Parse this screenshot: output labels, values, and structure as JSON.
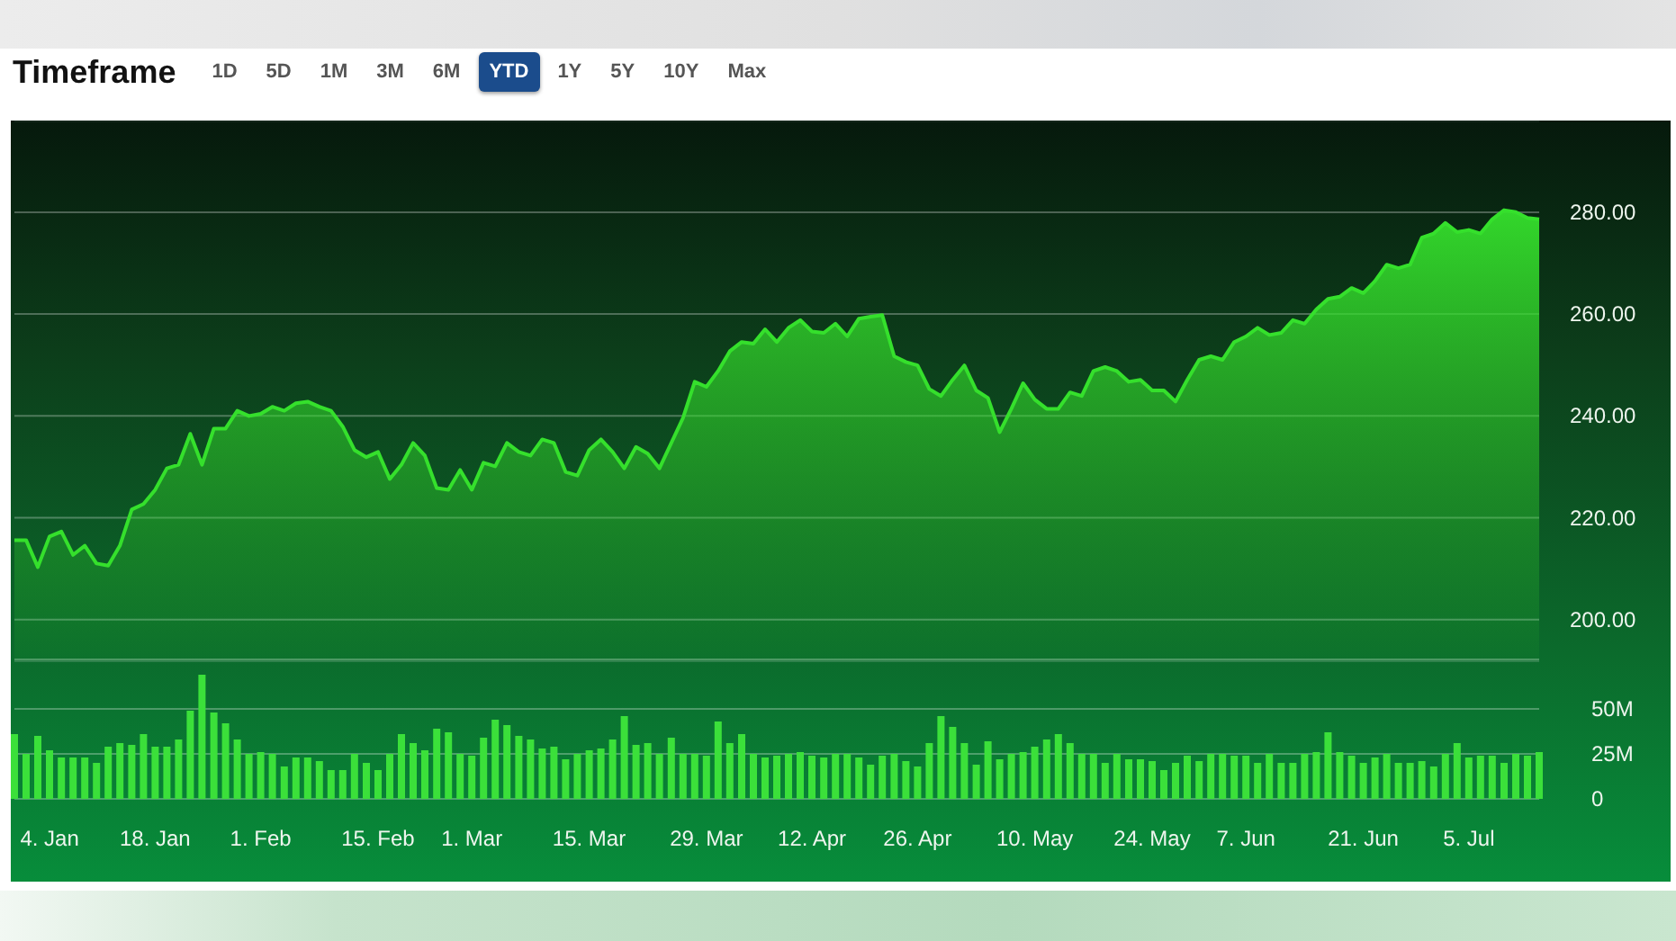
{
  "header": {
    "title": "Timeframe",
    "tabs": [
      {
        "label": "1D",
        "selected": false
      },
      {
        "label": "5D",
        "selected": false
      },
      {
        "label": "1M",
        "selected": false
      },
      {
        "label": "3M",
        "selected": false
      },
      {
        "label": "6M",
        "selected": false
      },
      {
        "label": "YTD",
        "selected": true
      },
      {
        "label": "1Y",
        "selected": false
      },
      {
        "label": "5Y",
        "selected": false
      },
      {
        "label": "10Y",
        "selected": false
      },
      {
        "label": "Max",
        "selected": false
      }
    ]
  },
  "price_chart": {
    "chart_data": {
      "type": "area",
      "grid": true,
      "ylim": [
        192,
        298
      ],
      "yticks": [
        {
          "value": 200,
          "label": "200.00"
        },
        {
          "value": 220,
          "label": "220.00"
        },
        {
          "value": 240,
          "label": "240.00"
        },
        {
          "value": 260,
          "label": "260.00"
        },
        {
          "value": 280,
          "label": "280.00"
        }
      ],
      "series": [
        {
          "color": "#35e02c",
          "values": [
            215.6,
            215.6,
            210.3,
            216.3,
            217.3,
            212.7,
            214.5,
            211.0,
            210.6,
            214.5,
            221.6,
            222.7,
            225.5,
            229.7,
            230.4,
            236.5,
            230.4,
            237.5,
            237.5,
            241.0,
            240.0,
            240.4,
            241.8,
            241.0,
            242.5,
            242.8,
            241.8,
            241.0,
            237.9,
            233.3,
            231.9,
            232.9,
            227.6,
            230.4,
            234.7,
            232.2,
            225.8,
            225.5,
            229.4,
            225.5,
            230.8,
            230.1,
            234.7,
            232.9,
            232.2,
            235.4,
            234.7,
            229.0,
            228.3,
            233.3,
            235.4,
            232.9,
            229.7,
            233.9,
            232.6,
            229.7,
            234.7,
            239.6,
            246.7,
            245.7,
            248.8,
            252.7,
            254.5,
            254.2,
            257.0,
            254.5,
            257.3,
            258.8,
            256.6,
            256.3,
            258.1,
            255.6,
            259.1,
            259.5,
            259.8,
            251.7,
            250.6,
            249.9,
            245.3,
            243.9,
            247.1,
            249.9,
            245.0,
            243.5,
            236.8,
            241.4,
            246.4,
            243.2,
            241.4,
            241.4,
            244.6,
            243.9,
            248.8,
            249.6,
            248.8,
            246.7,
            247.1,
            245.0,
            245.0,
            242.8,
            247.1,
            251.0,
            251.7,
            251.0,
            254.5,
            255.6,
            257.3,
            255.9,
            256.3,
            258.8,
            258.1,
            260.9,
            263.0,
            263.4,
            265.1,
            264.1,
            266.5,
            269.7,
            269.0,
            269.7,
            275.0,
            275.8,
            277.9,
            276.1,
            276.5,
            275.8,
            278.6,
            280.4,
            280.0,
            278.9,
            278.6
          ]
        }
      ]
    }
  },
  "volume_chart": {
    "chart_data": {
      "type": "bar",
      "grid": true,
      "ylim": [
        0,
        77
      ],
      "categories": [
        null,
        null,
        null,
        "4. Jan",
        null,
        null,
        null,
        null,
        null,
        null,
        null,
        null,
        "18. Jan",
        null,
        null,
        null,
        null,
        null,
        null,
        null,
        null,
        "1. Feb",
        null,
        null,
        null,
        null,
        null,
        null,
        null,
        null,
        null,
        "15. Feb",
        null,
        null,
        null,
        null,
        null,
        null,
        null,
        "1. Mar",
        null,
        null,
        null,
        null,
        null,
        null,
        null,
        null,
        null,
        "15. Mar",
        null,
        null,
        null,
        null,
        null,
        null,
        null,
        null,
        null,
        "29. Mar",
        null,
        null,
        null,
        null,
        null,
        null,
        null,
        null,
        "12. Apr",
        null,
        null,
        null,
        null,
        null,
        null,
        null,
        null,
        "26. Apr",
        null,
        null,
        null,
        null,
        null,
        null,
        null,
        null,
        null,
        "10. May",
        null,
        null,
        null,
        null,
        null,
        null,
        null,
        null,
        null,
        "24. May",
        null,
        null,
        null,
        null,
        null,
        null,
        null,
        "7. Jun",
        null,
        null,
        null,
        null,
        null,
        null,
        null,
        null,
        null,
        "21. Jun",
        null,
        null,
        null,
        null,
        null,
        null,
        null,
        null,
        "5. Jul",
        null,
        null,
        null,
        null,
        null,
        null
      ],
      "yticks": [
        {
          "value": 0,
          "label": "0"
        },
        {
          "value": 25,
          "label": "25M"
        },
        {
          "value": 50,
          "label": "50M"
        }
      ],
      "series": [
        {
          "color": "#3be03a",
          "values": [
            36,
            25,
            35,
            27,
            23,
            23,
            23,
            20,
            29,
            31,
            30,
            36,
            29,
            29,
            33,
            49,
            69,
            48,
            42,
            33,
            25,
            26,
            25,
            18,
            23,
            23,
            21,
            16,
            16,
            25,
            20,
            16,
            25,
            36,
            31,
            27,
            39,
            37,
            25,
            24,
            34,
            44,
            41,
            35,
            33,
            28,
            29,
            22,
            25,
            27,
            28,
            33,
            46,
            30,
            31,
            25,
            34,
            25,
            25,
            24,
            43,
            31,
            36,
            25,
            23,
            24,
            25,
            26,
            24,
            23,
            25,
            25,
            23,
            19,
            24,
            25,
            21,
            18,
            31,
            46,
            40,
            31,
            19,
            32,
            22,
            25,
            26,
            29,
            33,
            36,
            31,
            25,
            25,
            20,
            25,
            22,
            22,
            21,
            16,
            20,
            24,
            21,
            25,
            25,
            24,
            24,
            20,
            25,
            20,
            20,
            25,
            26,
            37,
            26,
            24,
            20,
            23,
            25,
            20,
            20,
            21,
            18,
            25,
            31,
            23,
            24,
            24,
            20,
            25,
            24,
            26
          ]
        }
      ]
    }
  }
}
